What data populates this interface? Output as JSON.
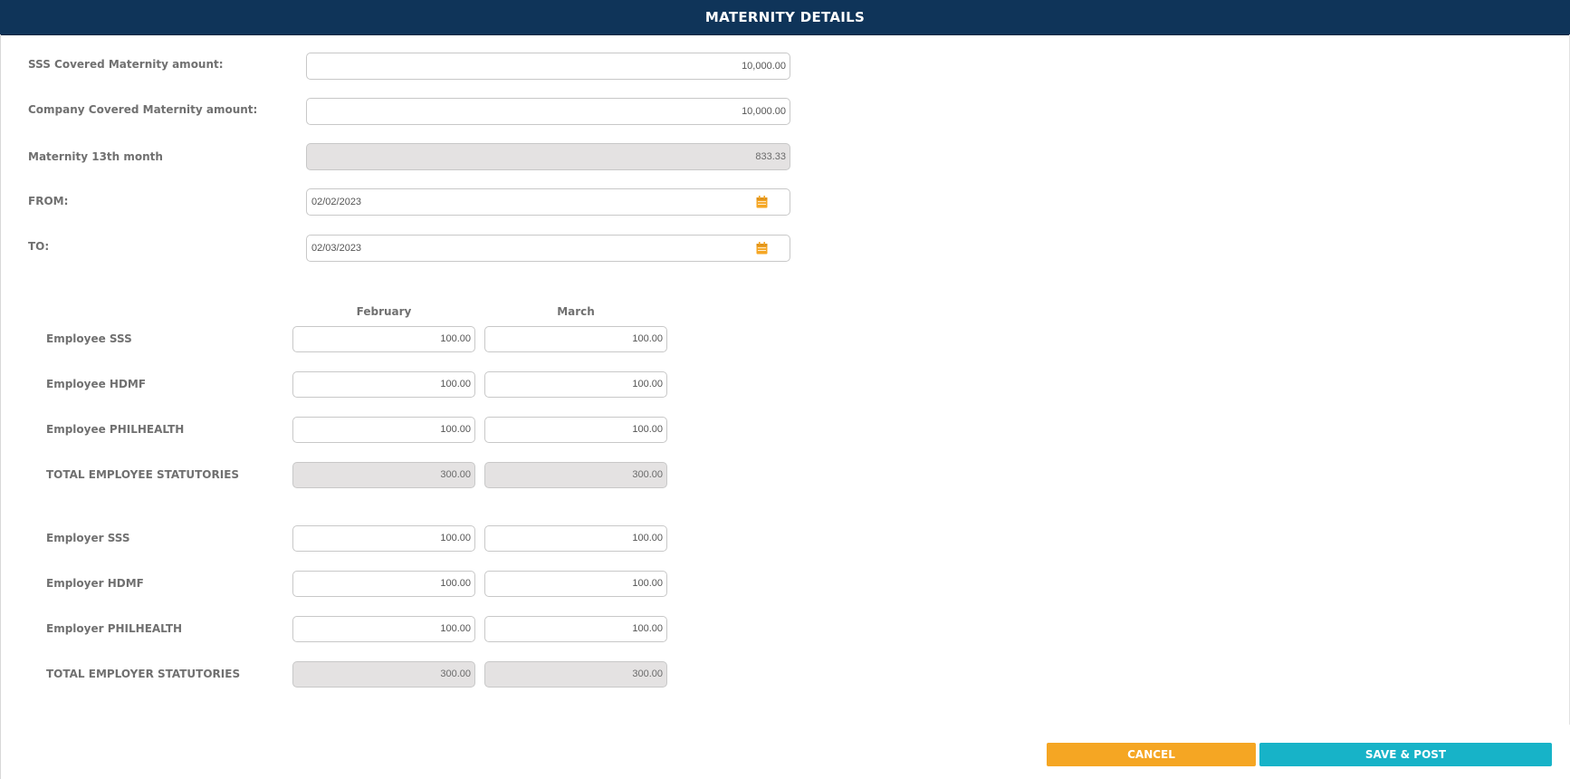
{
  "header": {
    "title": "MATERNITY DETAILS"
  },
  "colors": {
    "header_bg": "#0f3459",
    "cancel": "#f5a623",
    "save": "#17b3c8",
    "icon": "#f5a623",
    "readonly_bg": "#e4e2e2"
  },
  "form": {
    "sss_label": "SSS Covered Maternity amount:",
    "sss_value": "10,000.00",
    "company_label": "Company Covered Maternity amount:",
    "company_value": "10,000.00",
    "m13_label": "Maternity 13th month",
    "m13_value": "833.33",
    "from_label": "FROM:",
    "from_value": "02/02/2023",
    "to_label": "TO:",
    "to_value": "02/03/2023",
    "calendar_icon": "calendar-icon"
  },
  "table": {
    "col1": "February",
    "col2": "March",
    "rows": [
      {
        "label": "Employee SSS",
        "feb": "100.00",
        "mar": "100.00"
      },
      {
        "label": "Employee HDMF",
        "feb": "100.00",
        "mar": "100.00"
      },
      {
        "label": "Employee PHILHEALTH",
        "feb": "100.00",
        "mar": "100.00"
      },
      {
        "label": "TOTAL EMPLOYEE STATUTORIES",
        "feb": "300.00",
        "mar": "300.00"
      },
      {
        "label": "Employer SSS",
        "feb": "100.00",
        "mar": "100.00"
      },
      {
        "label": "Employer HDMF",
        "feb": "100.00",
        "mar": "100.00"
      },
      {
        "label": "Employer PHILHEALTH",
        "feb": "100.00",
        "mar": "100.00"
      },
      {
        "label": "TOTAL EMPLOYER STATUTORIES",
        "feb": "300.00",
        "mar": "300.00"
      }
    ]
  },
  "buttons": {
    "cancel": "CANCEL",
    "save": "SAVE & POST"
  }
}
